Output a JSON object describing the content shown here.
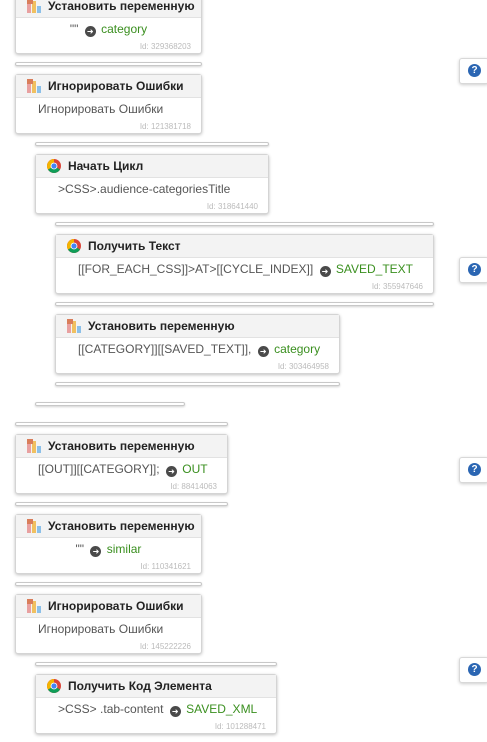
{
  "blocks": [
    {
      "title": "Установить переменную",
      "icon": "variable-icon",
      "value": "\"\"",
      "target": "category",
      "id": "Id: 329368203"
    },
    {
      "title": "Игнорировать Ошибки",
      "icon": "variable-icon",
      "text": "Игнорировать Ошибки",
      "id": "Id: 121381718"
    },
    {
      "title": "Начать Цикл",
      "icon": "chrome-icon",
      "text": ">CSS>.audience-categoriesTitle",
      "id": "Id: 318641440"
    },
    {
      "title": "Получить Текст",
      "icon": "chrome-icon",
      "value": "[[FOR_EACH_CSS]]>AT>[[CYCLE_INDEX]]",
      "target": "SAVED_TEXT",
      "id": "Id: 355947646"
    },
    {
      "title": "Установить переменную",
      "icon": "variable-icon",
      "value": "[[CATEGORY]][[SAVED_TEXT]],",
      "target": "category",
      "id": "Id: 303464958"
    },
    {
      "title": "Установить переменную",
      "icon": "variable-icon",
      "value": "[[OUT]][[CATEGORY]];",
      "target": "OUT",
      "id": "Id: 88414063"
    },
    {
      "title": "Установить переменную",
      "icon": "variable-icon",
      "value": "\"\"",
      "target": "similar",
      "id": "Id: 110341621"
    },
    {
      "title": "Игнорировать Ошибки",
      "icon": "variable-icon",
      "text": "Игнорировать Ошибки",
      "id": "Id: 145222226"
    },
    {
      "title": "Получить Код Элемента",
      "icon": "chrome-icon",
      "value": ">CSS> .tab-content",
      "target": "SAVED_XML",
      "id": "Id: 101288471"
    }
  ],
  "help": {
    "label": "?"
  }
}
